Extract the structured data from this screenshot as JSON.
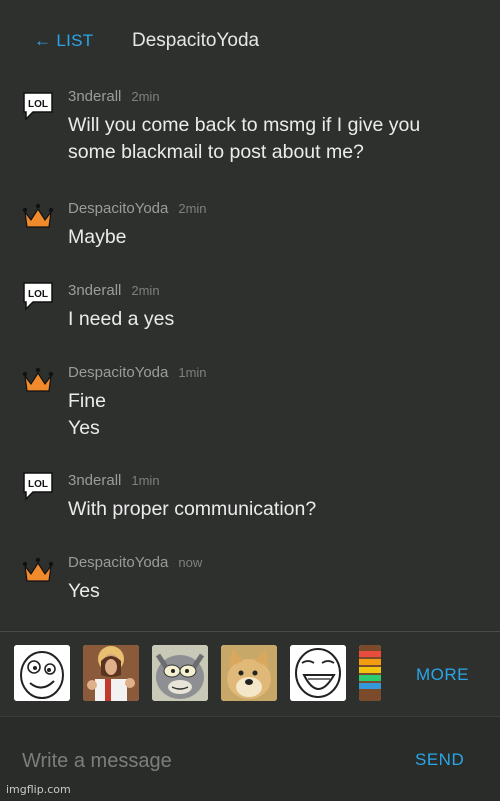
{
  "header": {
    "back_label": "← LIST",
    "title": "DespacitoYoda"
  },
  "messages": [
    {
      "user": "3nderall",
      "time": "2min",
      "avatar": "lol-speech-bubble-icon",
      "lines": [
        "Will you come back to msmg if I give you",
        "some blackmail to post about me?"
      ]
    },
    {
      "user": "DespacitoYoda",
      "time": "2min",
      "avatar": "crown-icon",
      "lines": [
        "Maybe"
      ]
    },
    {
      "user": "3nderall",
      "time": "2min",
      "avatar": "lol-speech-bubble-icon",
      "lines": [
        "I need a yes"
      ]
    },
    {
      "user": "DespacitoYoda",
      "time": "1min",
      "avatar": "crown-icon",
      "lines": [
        "Fine",
        "Yes"
      ]
    },
    {
      "user": "3nderall",
      "time": "1min",
      "avatar": "lol-speech-bubble-icon",
      "lines": [
        "With proper communication?"
      ]
    },
    {
      "user": "DespacitoYoda",
      "time": "now",
      "avatar": "crown-icon",
      "lines": [
        "Yes"
      ]
    }
  ],
  "avatar_badge_text": "LOL",
  "stickers": [
    "derp-face-sticker",
    "buddy-christ-sticker",
    "tom-cat-sticker",
    "doge-sticker",
    "lol-face-sticker",
    "rainbow-sticker"
  ],
  "tray": {
    "more_label": "MORE"
  },
  "composer": {
    "placeholder": "Write a message",
    "send_label": "SEND"
  },
  "watermark": "imgflip.com",
  "colors": {
    "accent": "#2aa6e8",
    "background": "#2e302e",
    "crown": "#f08a2c"
  }
}
